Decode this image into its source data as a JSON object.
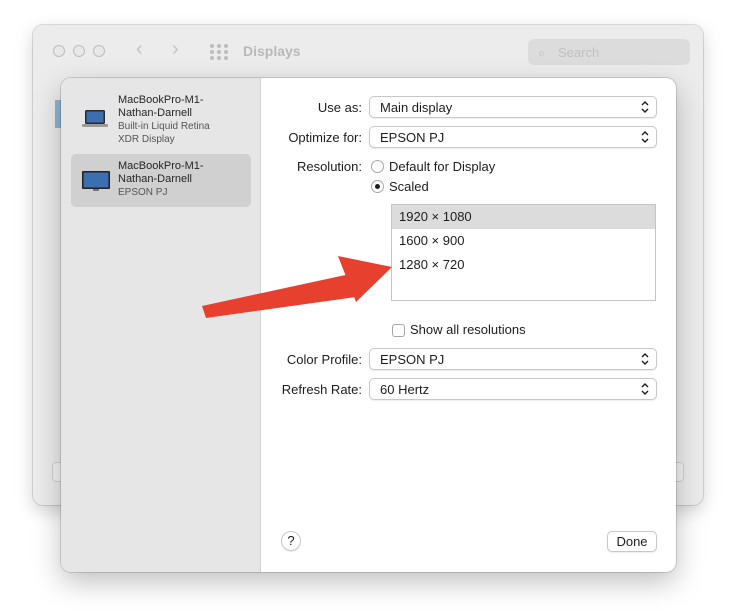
{
  "window": {
    "title": "Displays",
    "search_placeholder": "Search"
  },
  "sidebar": {
    "displays": [
      {
        "name_line1": "MacBookPro-M1-",
        "name_line2": "Nathan-Darnell",
        "subtitle_line1": "Built-in Liquid Retina",
        "subtitle_line2": "XDR Display",
        "selected": false,
        "icon": "laptop-icon"
      },
      {
        "name_line1": "MacBookPro-M1-",
        "name_line2": "Nathan-Darnell",
        "subtitle_line1": "EPSON PJ",
        "subtitle_line2": "",
        "selected": true,
        "icon": "monitor-icon"
      }
    ]
  },
  "settings": {
    "use_as": {
      "label": "Use as:",
      "value": "Main display"
    },
    "optimize_for": {
      "label": "Optimize for:",
      "value": "EPSON PJ"
    },
    "resolution": {
      "label": "Resolution:",
      "options": [
        "Default for Display",
        "Scaled"
      ],
      "selected_option": "Scaled",
      "list": [
        "1920 × 1080",
        "1600 × 900",
        "1280 × 720"
      ],
      "selected_resolution": "1920 × 1080"
    },
    "show_all_resolutions": {
      "label": "Show all resolutions",
      "checked": false
    },
    "color_profile": {
      "label": "Color Profile:",
      "value": "EPSON PJ"
    },
    "refresh_rate": {
      "label": "Refresh Rate:",
      "value": "60 Hertz"
    }
  },
  "buttons": {
    "help": "?",
    "done": "Done"
  },
  "annotation": {
    "arrow_color": "#e8402e",
    "points_to": "1280 × 720"
  },
  "colors": {
    "sidebar_bg": "#e6e6e6",
    "selected_row": "#d0d0d0",
    "list_selection": "#dcdcdc"
  }
}
